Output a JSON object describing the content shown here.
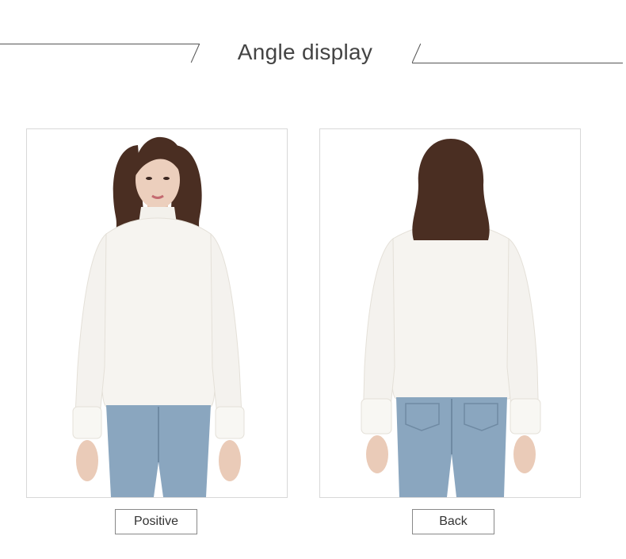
{
  "header": {
    "title": "Angle display"
  },
  "panels": [
    {
      "label": "Positive",
      "view": "front"
    },
    {
      "label": "Back",
      "view": "back"
    }
  ],
  "colors": {
    "line": "#555555",
    "sweater": "#f6f4f0",
    "jeans": "#8aa6bf",
    "hair": "#4a2e22",
    "skin": "#eacbb8"
  }
}
